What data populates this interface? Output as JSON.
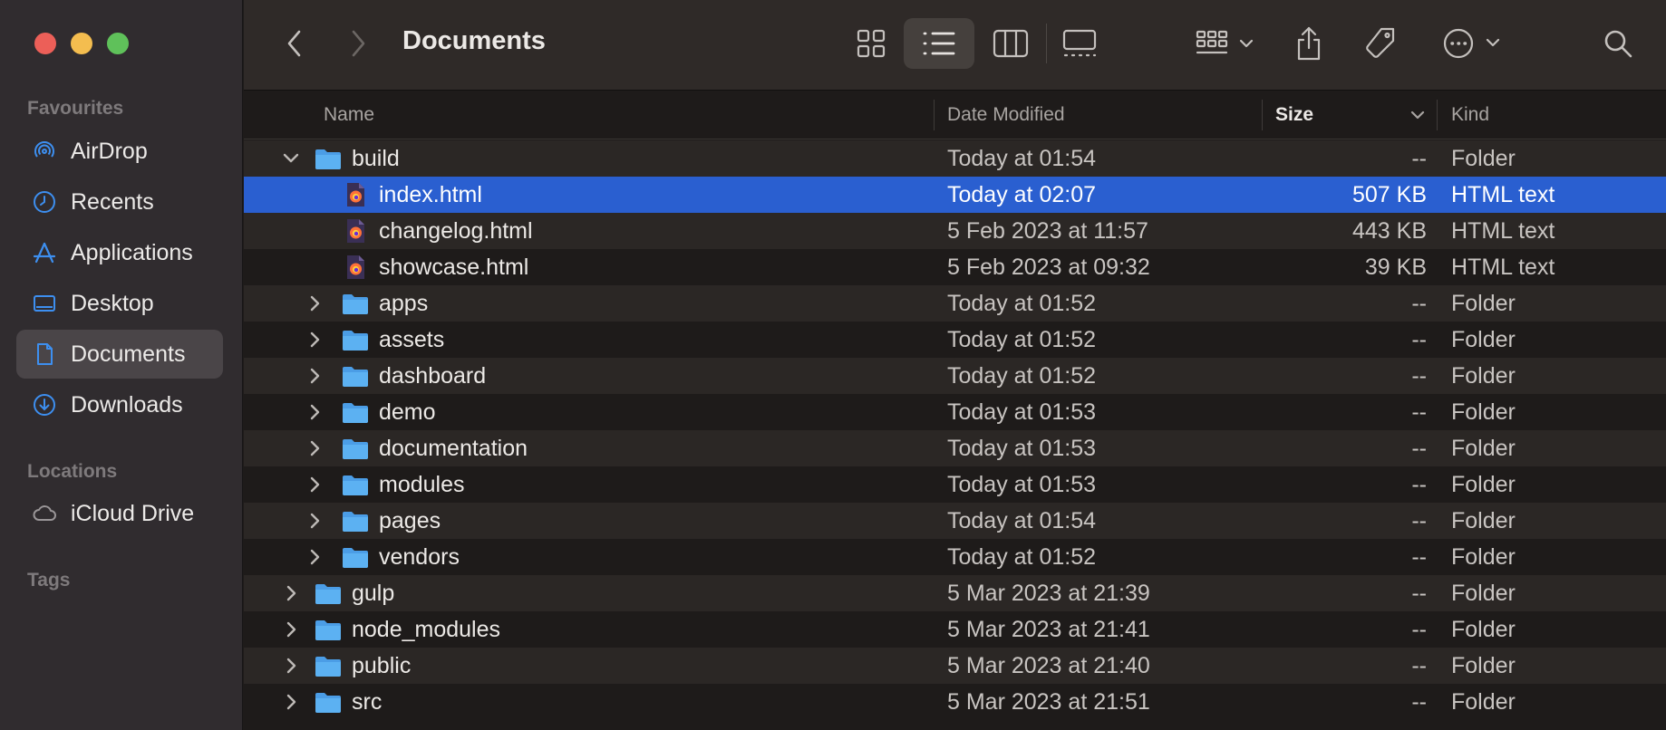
{
  "window": {
    "title": "Documents"
  },
  "sidebar": {
    "sections": [
      {
        "label": "Favourites"
      },
      {
        "label": "Locations"
      },
      {
        "label": "Tags"
      }
    ],
    "favourites": [
      {
        "label": "AirDrop",
        "icon": "airdrop-icon"
      },
      {
        "label": "Recents",
        "icon": "clock-icon"
      },
      {
        "label": "Applications",
        "icon": "applications-icon"
      },
      {
        "label": "Desktop",
        "icon": "desktop-icon"
      },
      {
        "label": "Documents",
        "icon": "document-icon",
        "active": true
      },
      {
        "label": "Downloads",
        "icon": "download-icon"
      }
    ],
    "locations": [
      {
        "label": "iCloud Drive",
        "icon": "cloud-icon"
      }
    ]
  },
  "columns": {
    "name": "Name",
    "date": "Date Modified",
    "size": "Size",
    "kind": "Kind"
  },
  "rows": [
    {
      "name": "build",
      "date": "Today at 01:54",
      "size": "--",
      "kind": "Folder",
      "type": "folder",
      "expanded": true
    },
    {
      "name": "index.html",
      "date": "Today at 02:07",
      "size": "507 KB",
      "kind": "HTML text",
      "type": "html",
      "selected": true
    },
    {
      "name": "changelog.html",
      "date": "5 Feb 2023 at 11:57",
      "size": "443 KB",
      "kind": "HTML text",
      "type": "html"
    },
    {
      "name": "showcase.html",
      "date": "5 Feb 2023 at 09:32",
      "size": "39 KB",
      "kind": "HTML text",
      "type": "html"
    },
    {
      "name": "apps",
      "date": "Today at 01:52",
      "size": "--",
      "kind": "Folder",
      "type": "folder"
    },
    {
      "name": "assets",
      "date": "Today at 01:52",
      "size": "--",
      "kind": "Folder",
      "type": "folder"
    },
    {
      "name": "dashboard",
      "date": "Today at 01:52",
      "size": "--",
      "kind": "Folder",
      "type": "folder"
    },
    {
      "name": "demo",
      "date": "Today at 01:53",
      "size": "--",
      "kind": "Folder",
      "type": "folder"
    },
    {
      "name": "documentation",
      "date": "Today at 01:53",
      "size": "--",
      "kind": "Folder",
      "type": "folder"
    },
    {
      "name": "modules",
      "date": "Today at 01:53",
      "size": "--",
      "kind": "Folder",
      "type": "folder"
    },
    {
      "name": "pages",
      "date": "Today at 01:54",
      "size": "--",
      "kind": "Folder",
      "type": "folder"
    },
    {
      "name": "vendors",
      "date": "Today at 01:52",
      "size": "--",
      "kind": "Folder",
      "type": "folder"
    },
    {
      "name": "gulp",
      "date": "5 Mar 2023 at 21:39",
      "size": "--",
      "kind": "Folder",
      "type": "folder"
    },
    {
      "name": "node_modules",
      "date": "5 Mar 2023 at 21:41",
      "size": "--",
      "kind": "Folder",
      "type": "folder"
    },
    {
      "name": "public",
      "date": "5 Mar 2023 at 21:40",
      "size": "--",
      "kind": "Folder",
      "type": "folder"
    },
    {
      "name": "src",
      "date": "5 Mar 2023 at 21:51",
      "size": "--",
      "kind": "Folder",
      "type": "folder"
    }
  ],
  "colors": {
    "selection": "#2a5fd0",
    "accent": "#3d8ff0",
    "folder": "#55a8ee"
  }
}
